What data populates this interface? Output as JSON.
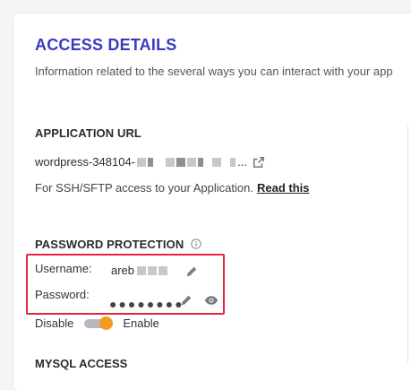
{
  "access": {
    "title": "ACCESS DETAILS",
    "description": "Information related to the several ways you can interact with your app"
  },
  "application_url": {
    "title": "APPLICATION URL",
    "url_prefix": "wordpress-348104-",
    "url_suffix": "...",
    "ssh_text": "For SSH/SFTP access to your Application.",
    "read_this": "Read this"
  },
  "password_protection": {
    "title": "PASSWORD PROTECTION",
    "username_label": "Username:",
    "username_value": "areb",
    "password_label": "Password:",
    "password_value": "●●●●●●●●",
    "disable_label": "Disable",
    "enable_label": "Enable"
  },
  "mysql": {
    "title": "MYSQL ACCESS"
  },
  "colors": {
    "accent": "#3a3cbf",
    "toggle_on": "#f59a1f",
    "highlight": "#e4263a"
  },
  "icons": {
    "external_link": "external-link-icon",
    "info": "info-icon",
    "edit": "pencil-icon",
    "show": "eye-icon"
  }
}
